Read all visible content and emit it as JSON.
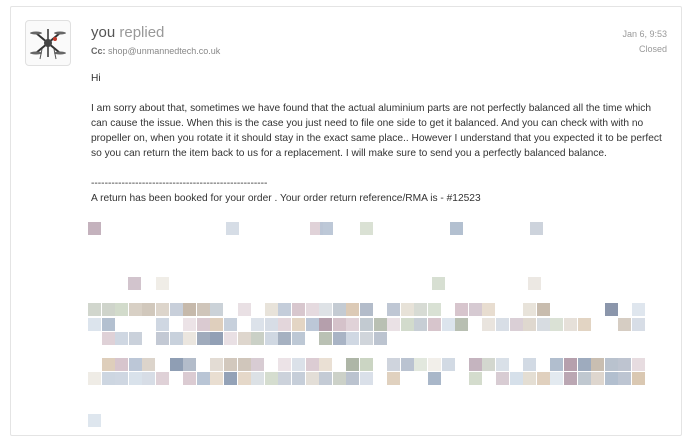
{
  "message": {
    "sender": "you",
    "action": "replied",
    "cc_label": "Cc:",
    "cc_value": "shop@unmannedtech.co.uk",
    "date": "Jan 6, 9:53",
    "status": "Closed",
    "greeting": "Hi",
    "paragraph": "I am sorry about that, sometimes we have found that the actual aluminium parts are not perfectly balanced all the time which can cause the issue. When this is the case you just need to file one side to get it balanced. And you can check with with no propeller on, when you rotate it it should stay in the exact same place.. However I understand that you expected it to be perfect so you can return the item back to us for a replacement. I will make sure to send you a perfectly balanced balance.",
    "separator": "----------------------------------------------------",
    "return_line": "A return has been booked for your order . Your order return reference/RMA is - #12523"
  },
  "icons": {
    "avatar": "drone-icon"
  }
}
